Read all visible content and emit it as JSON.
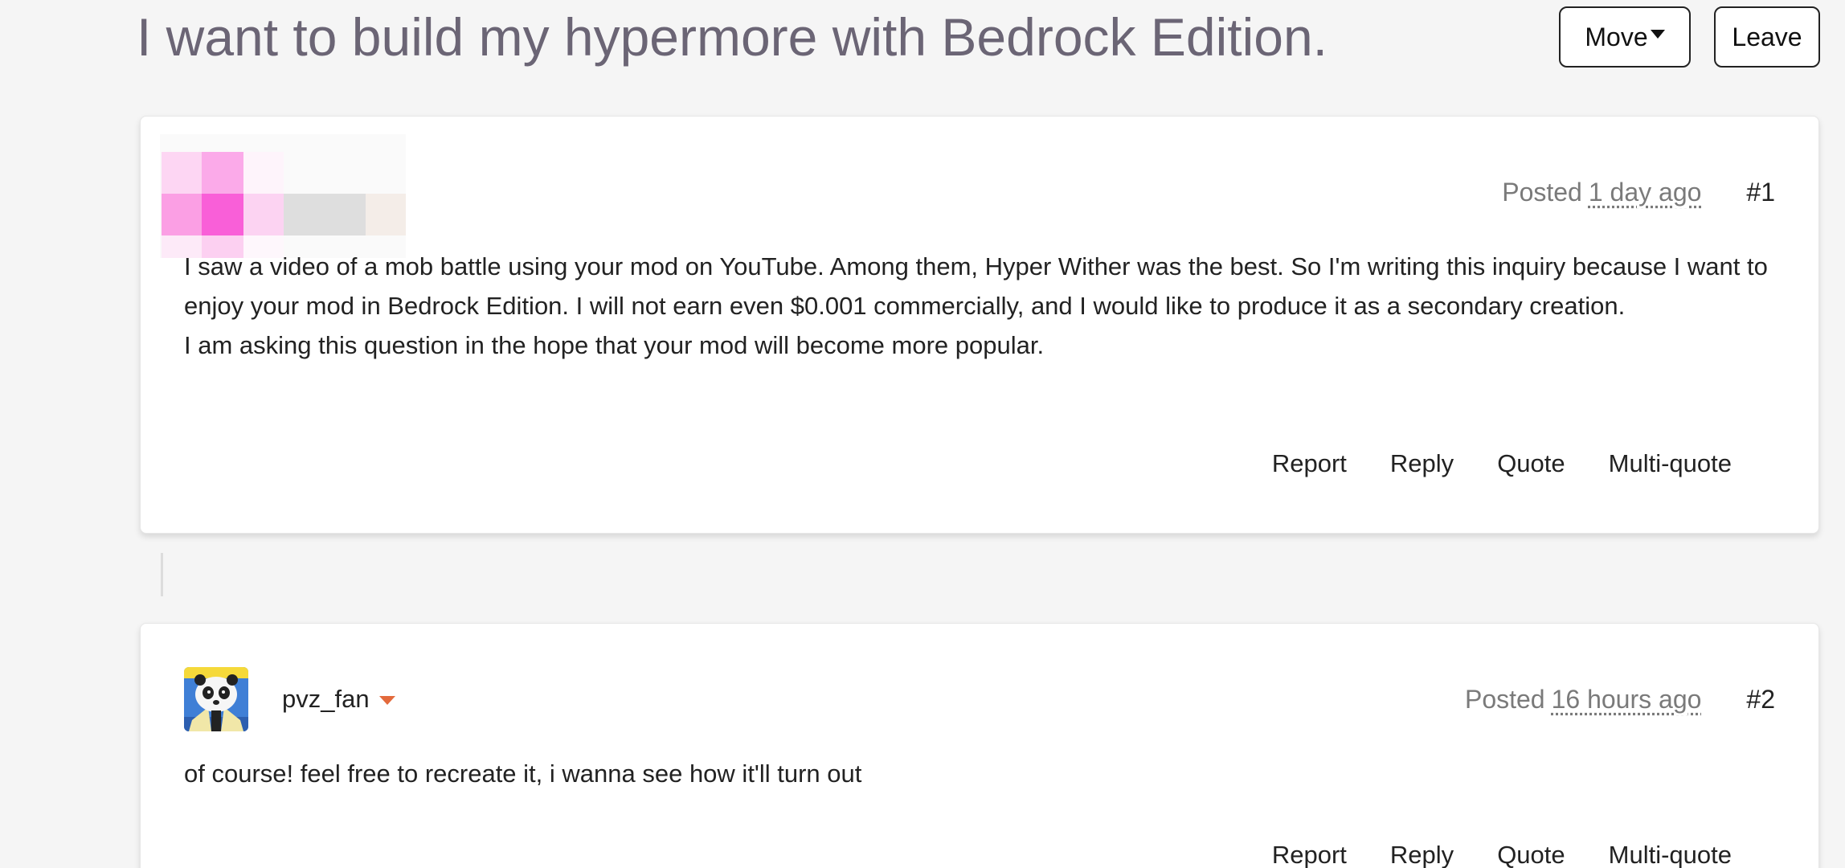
{
  "thread": {
    "title": "I want to build my hypermore with Bedrock Edition.",
    "move_label": "Move",
    "leave_label": "Leave"
  },
  "posts": [
    {
      "posted_label": "Posted",
      "posted_time": "1 day ago",
      "number": "#1",
      "paragraphs": [
        "I saw a video of a mob battle using your mod on YouTube. Among them, Hyper Wither was the best. So I'm writing this inquiry because I want to enjoy your mod in Bedrock Edition. I will not earn even $0.001 commercially, and I would like to produce it as a secondary creation.",
        "I am asking this question in the hope that your mod will become more popular."
      ],
      "actions": {
        "report": "Report",
        "reply": "Reply",
        "quote": "Quote",
        "multi_quote": "Multi-quote"
      }
    },
    {
      "author": "pvz_fan",
      "posted_label": "Posted",
      "posted_time": "16 hours ago",
      "number": "#2",
      "paragraphs": [
        "of course! feel free to recreate it, i wanna see how it'll turn out"
      ],
      "actions": {
        "report": "Report",
        "reply": "Reply",
        "quote": "Quote",
        "multi_quote": "Multi-quote"
      }
    }
  ],
  "colors": {
    "title": "#6b6575",
    "author_caret": "#e36a3c",
    "avatar_pink": "#f95fd8"
  }
}
